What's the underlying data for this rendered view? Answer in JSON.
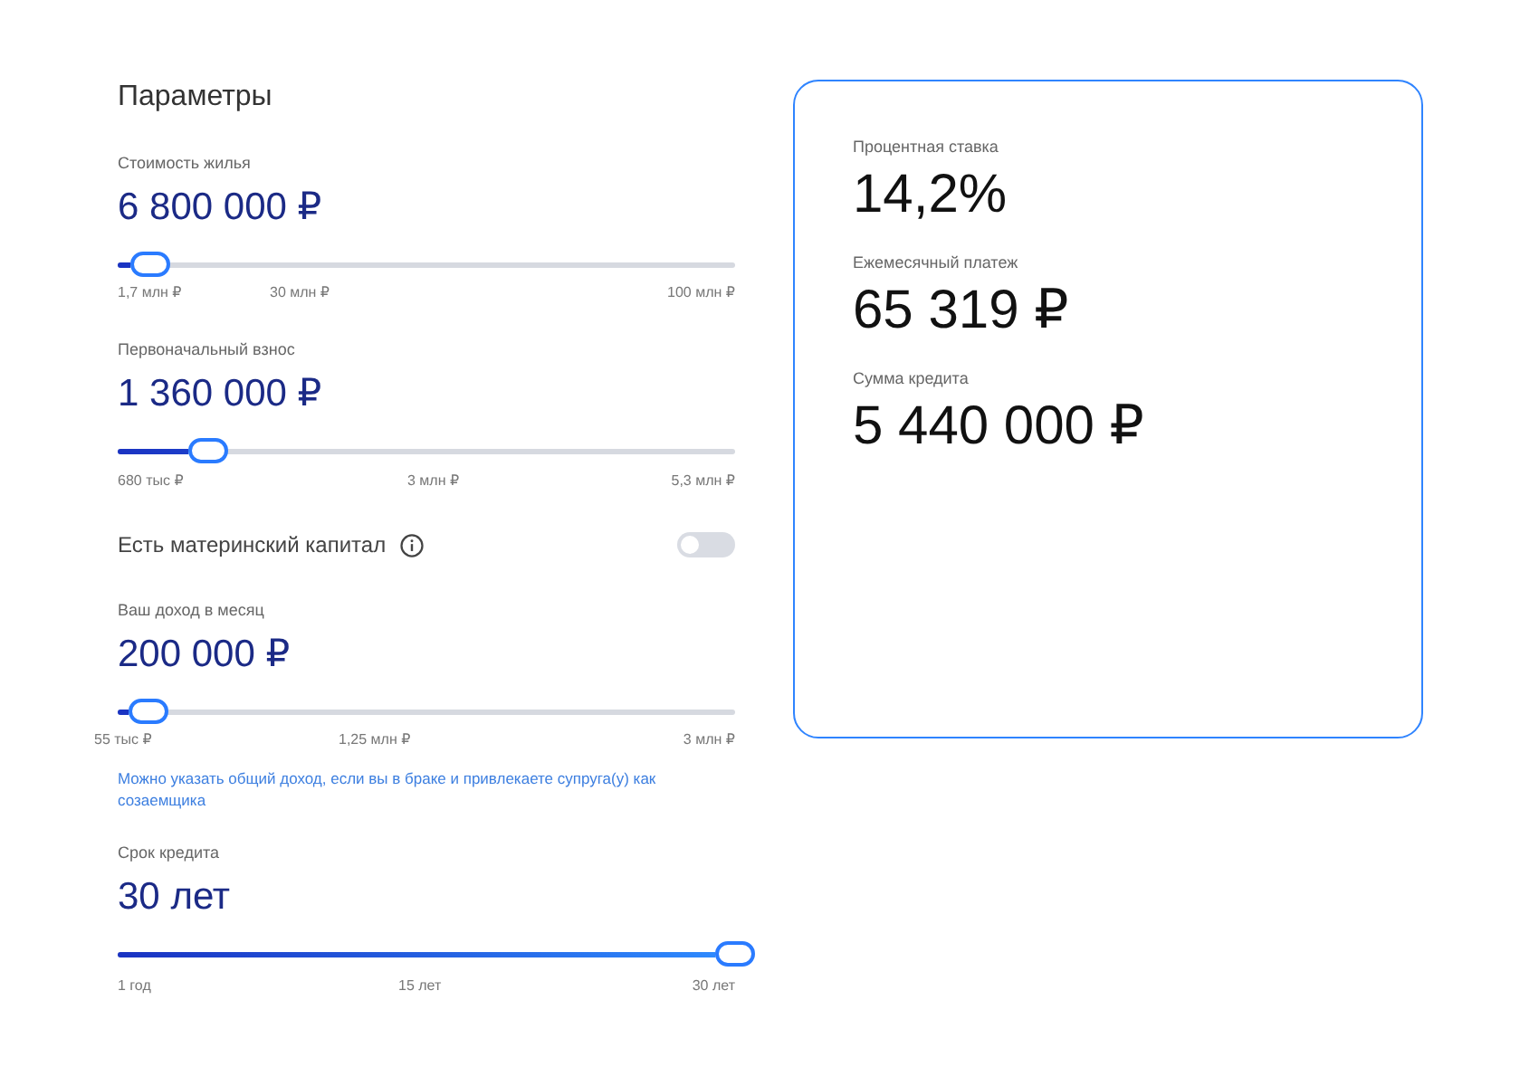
{
  "parameters": {
    "title": "Параметры",
    "fields": [
      {
        "kind": "slider",
        "label": "Стоимость жилья",
        "value": "6 800 000 ₽",
        "level": 0.052,
        "ticks": [
          "1,7 млн ₽",
          "30 млн ₽",
          "100 млн ₽"
        ]
      },
      {
        "kind": "slider",
        "label": "Первоначальный взнос",
        "value": "1 360 000 ₽",
        "level": 0.147,
        "ticks": [
          "680 тыс ₽",
          "3 млн ₽",
          "5,3 млн ₽"
        ]
      },
      {
        "kind": "toggle",
        "label": "Есть материнский капитал",
        "on": false
      },
      {
        "kind": "slider",
        "label": "Ваш доход в месяц",
        "value": "200 000 ₽",
        "level": 0.049,
        "ticks": [
          "55 тыс ₽",
          "1,25 млн ₽",
          "3 млн ₽"
        ],
        "hint": "Можно указать общий доход, если вы в браке и привлекаете супруга(у) как созаемщика"
      },
      {
        "kind": "slider",
        "label": "Срок кредита",
        "value": "30 лет",
        "level": 1,
        "ticks": [
          "1 год",
          "15 лет",
          "30 лет"
        ]
      }
    ]
  },
  "summary": {
    "items": [
      {
        "label": "Процентная ставка",
        "value": "14,2%"
      },
      {
        "label": "Ежемесячный платеж",
        "value": "65 319 ₽"
      },
      {
        "label": "Сумма кредита",
        "value": "5 440 000 ₽"
      }
    ]
  }
}
